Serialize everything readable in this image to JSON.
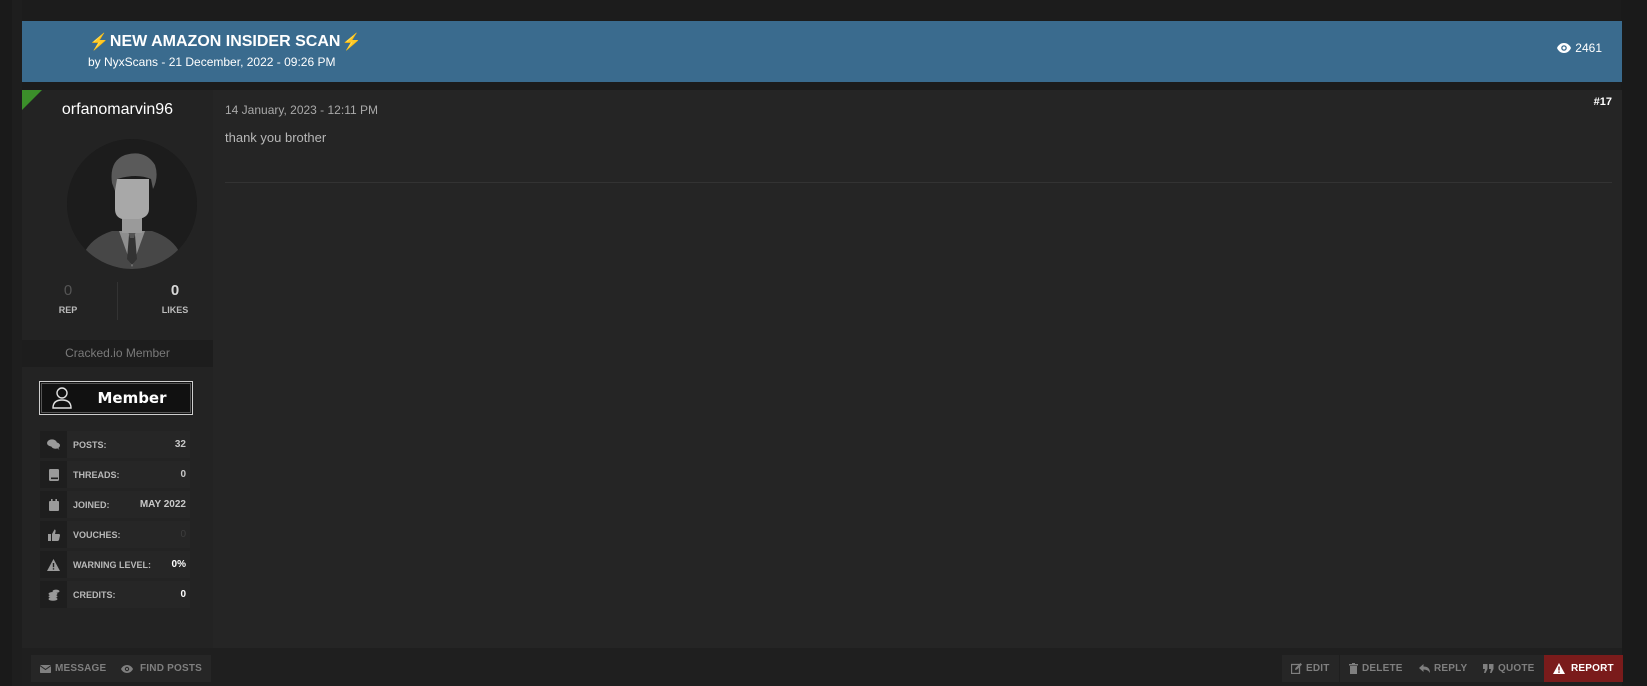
{
  "thread": {
    "title": "NEW AMAZON INSIDER SCAN",
    "title_prefix_icon": "lightning-bolt-icon",
    "title_suffix_icon": "lightning-bolt-icon",
    "bolt_glyph": "⚡",
    "meta": "by NyxScans - 21 December, 2022 - 09:26 PM",
    "views": "2461",
    "views_icon": "eye-icon",
    "header_color": "#3a6b8e"
  },
  "post": {
    "number": "#17",
    "date": "14 January, 2023 - 12:11 PM",
    "body": "thank you brother",
    "author": {
      "username": "orfanomarvin96",
      "avatar_icon": "default-avatar-icon",
      "online_flag_color": "#3b8f2a",
      "rep_value": "0",
      "rep_label": "REP",
      "likes_value": "0",
      "likes_label": "LIKES",
      "usertitle": "Cracked.io Member",
      "rank_badge": "Member",
      "info": [
        {
          "icon": "comments-icon",
          "label": "POSTS:",
          "value": "32"
        },
        {
          "icon": "book-icon",
          "label": "THREADS:",
          "value": "0"
        },
        {
          "icon": "calendar-icon",
          "label": "JOINED:",
          "value": "MAY 2022"
        },
        {
          "icon": "thumbs-up-icon",
          "label": "VOUCHES:",
          "value": "0"
        },
        {
          "icon": "warning-icon",
          "label": "WARNING LEVEL:",
          "value": "0%"
        },
        {
          "icon": "coins-icon",
          "label": "CREDITS:",
          "value": "0"
        }
      ]
    }
  },
  "footer": {
    "left_buttons": [
      {
        "icon": "envelope-icon",
        "label": "MESSAGE"
      },
      {
        "icon": "eye-icon",
        "label": "FIND POSTS"
      }
    ],
    "right_buttons": [
      {
        "icon": "edit-icon",
        "label": "EDIT"
      },
      {
        "icon": "trash-icon",
        "label": "DELETE"
      },
      {
        "icon": "reply-icon",
        "label": "REPLY"
      },
      {
        "icon": "quote-icon",
        "label": "QUOTE"
      },
      {
        "icon": "warning-icon",
        "label": "REPORT"
      }
    ],
    "report_color": "#7a1b1b"
  }
}
